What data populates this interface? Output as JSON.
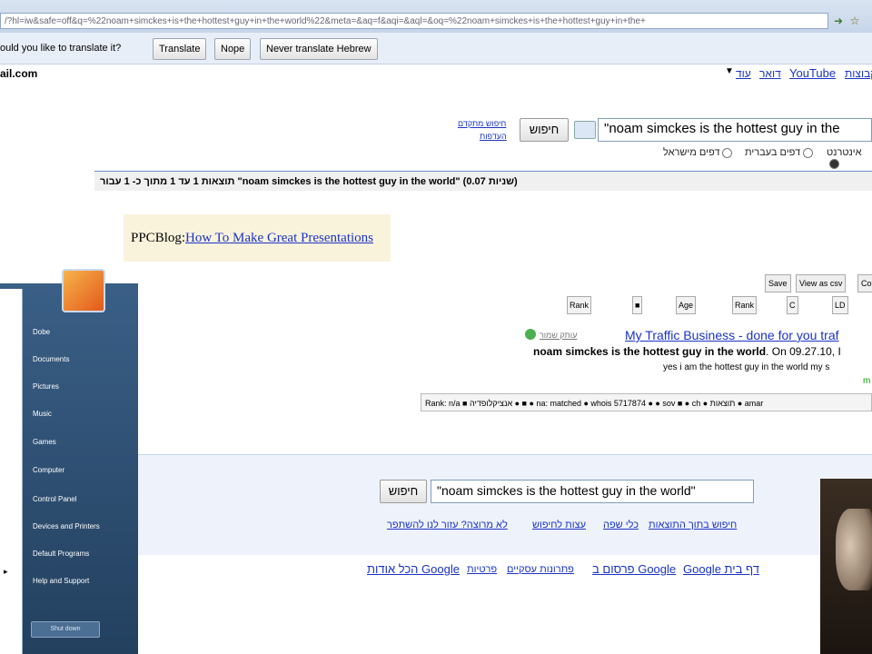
{
  "browser": {
    "address_url": "/?hl=iw&safe=off&q=%22noam+simckes+is+the+hottest+guy+in+the+world%22&meta=&aq=f&aqi=&aql=&oq=%22noam+simckes+is+the+hottest+guy+in+the+"
  },
  "translate_bar": {
    "prompt": "ould you like to translate it?",
    "translate_label": "Translate",
    "nope_label": "Nope",
    "never_label": "Never translate Hebrew"
  },
  "top_nav": {
    "email": "ail.com",
    "links": [
      "YouTube",
      "דואר",
      "עוד",
      "קבוצות"
    ],
    "more_arrow": "▼"
  },
  "search": {
    "query": "\"noam simckes is the hottest guy in the",
    "button_label": "חיפוש",
    "advanced_label": "חיפוש מתקדם",
    "advanced_label2": "העדפות",
    "radio_options": [
      "אינטרנט",
      "דפים בעברית",
      "דפים מישראל"
    ]
  },
  "stats": {
    "text": "תוצאות 1 עד 1 מתוך כ- 1 עבור \"noam simckes is the hottest guy in the world\" (0.07 שניות)"
  },
  "ad": {
    "prefix": "PPCBlog:",
    "link": "How To Make Great Presentations"
  },
  "seo_toolbar": {
    "buttons": [
      "Save",
      "View as csv",
      "Co"
    ],
    "badges": [
      "Rank",
      "■",
      "Age",
      "Rank",
      "C",
      "LD"
    ]
  },
  "result": {
    "title": "My Traffic Business - done for you traf",
    "cache": "עותק שמור",
    "snippet_bold": "noam simckes is the hottest guy in the world",
    "snippet_date": ". On 09.27.10, I",
    "snippet_line2": "yes i am the hottest guy in the world my s",
    "snippet_line3": "m",
    "seo_row": "Rank: n/a  ■ אנציקלופדיה  ●  ■ ●  na: matched  ● whois  5717874  ●  ●  sov ■  ● ch  ● תוצאות  ● amar"
  },
  "bottom_search": {
    "query": "\"noam simckes is the hottest guy in the world\"",
    "button_label": "חיפוש",
    "links": [
      "חיפוש בתוך התוצאות",
      "כלי שפה",
      "עצות לחיפוש",
      "לא מרוצה? עזור לנו להשתפר"
    ]
  },
  "footer": {
    "links": [
      "Google דף בית",
      "פרסום ב Google",
      "פתרונות עסקיים",
      "פרטיות",
      "הכל אודות Google"
    ]
  },
  "start_menu": {
    "items": [
      "Dobe",
      "Documents",
      "Pictures",
      "Music",
      "Games",
      "Computer",
      "Control Panel",
      "Devices and Printers",
      "Default Programs",
      "Help and Support"
    ],
    "shutdown_label": "Shut down",
    "left_arrow": "▸"
  }
}
